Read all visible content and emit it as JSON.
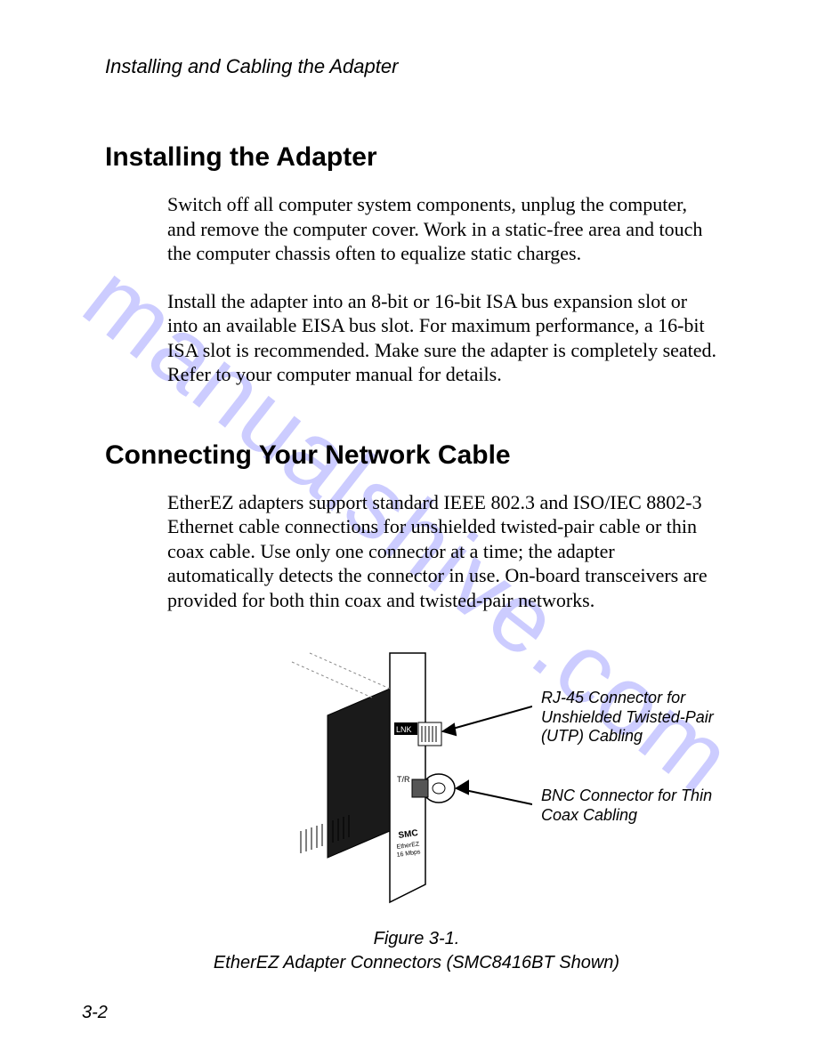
{
  "header": {
    "running_title": "Installing and Cabling the Adapter"
  },
  "sections": {
    "s1": {
      "heading": "Installing the Adapter",
      "p1": "Switch off all computer system components, unplug the computer, and remove the computer cover. Work in a static-free area and touch the computer chassis often to equalize static charges.",
      "p2": "Install the adapter into an 8-bit or 16-bit ISA bus expansion slot or into an available EISA bus slot. For maximum performance, a 16-bit ISA slot is recommended. Make sure the adapter is completely seated. Refer to your computer manual for details."
    },
    "s2": {
      "heading": "Connecting Your Network Cable",
      "p1": "EtherEZ adapters support standard IEEE 802.3 and ISO/IEC 8802-3 Ethernet cable connections for unshielded twisted-pair cable or thin coax cable. Use only one connector at a time; the adapter automatically detects the connector in use. On-board trans­ceivers are provided for both thin coax and twisted-pair networks."
    }
  },
  "figure": {
    "callout1": "RJ-45 Connector for Unshielded Twisted-Pair (UTP) Cabling",
    "callout2": "BNC Connector for Thin Coax Cabling",
    "label_lnk": "LNK",
    "label_tr": "T/R",
    "label_brand": "SMC",
    "label_model_l1": "EtherEZ",
    "label_model_l2": "16 Mbps",
    "caption_line1": "Figure 3-1.",
    "caption_line2": "EtherEZ Adapter Connectors (SMC8416BT Shown)"
  },
  "watermark": "manualshive.com",
  "page_number": "3-2"
}
